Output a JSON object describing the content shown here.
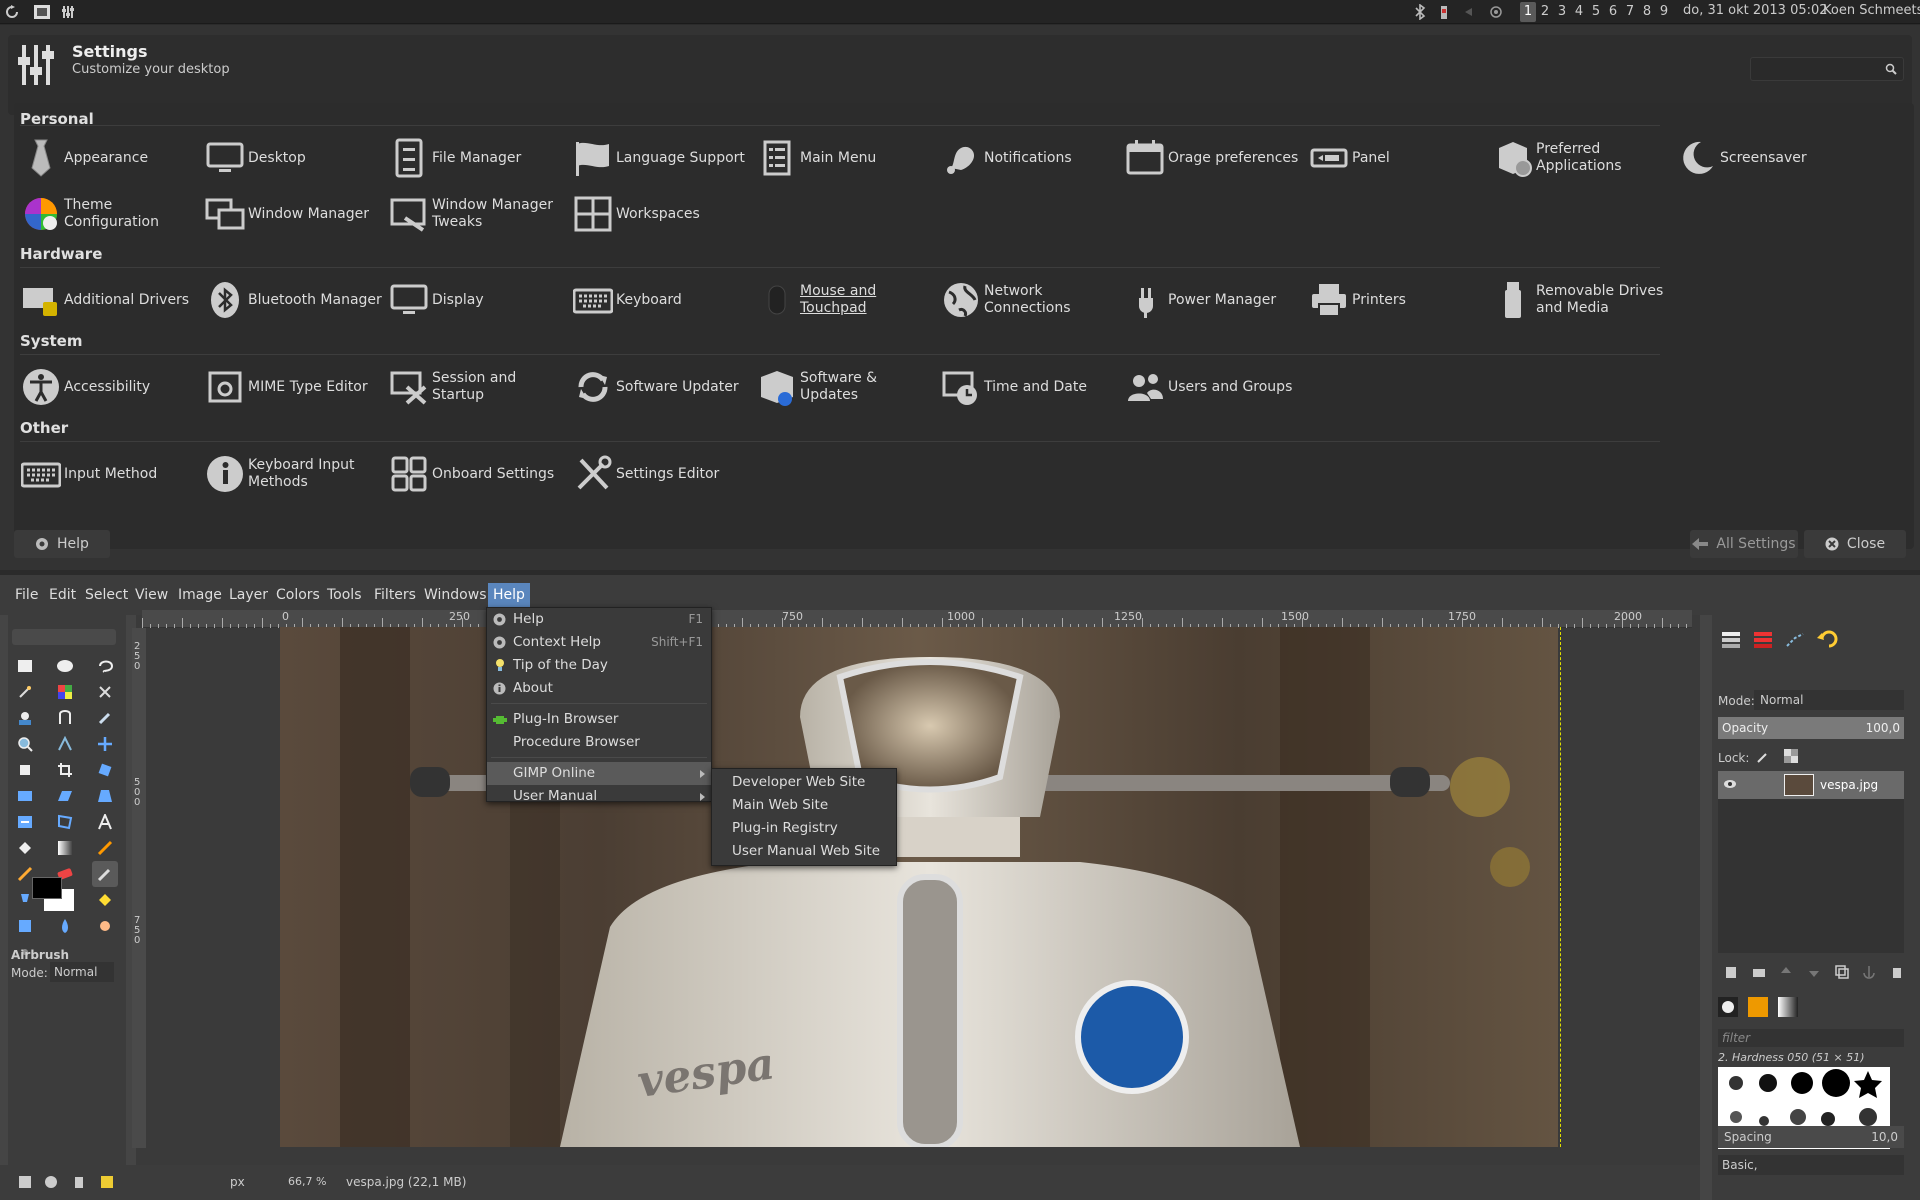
{
  "top_panel": {
    "workspaces": [
      "1",
      "2",
      "3",
      "4",
      "5",
      "6",
      "7",
      "8",
      "9"
    ],
    "active_workspace": "1",
    "datetime": "do, 31 okt 2013 05:02",
    "user": "Koen Schmeets"
  },
  "settings": {
    "title": "Settings",
    "subtitle": "Customize your desktop",
    "search_placeholder": "",
    "sections": {
      "personal": {
        "label": "Personal",
        "items": [
          {
            "label": "Appearance",
            "icon": "tie-icon"
          },
          {
            "label": "Desktop",
            "icon": "monitor-icon"
          },
          {
            "label": "File Manager",
            "icon": "file-cabinet-icon"
          },
          {
            "label": "Language Support",
            "icon": "flag-icon"
          },
          {
            "label": "Main Menu",
            "icon": "menu-list-icon"
          },
          {
            "label": "Notifications",
            "icon": "bell-icon"
          },
          {
            "label": "Orage preferences",
            "icon": "calendar-icon"
          },
          {
            "label": "Panel",
            "icon": "panel-icon"
          },
          {
            "label": "Preferred Applications",
            "icon": "applications-icon"
          },
          {
            "label": "Screensaver",
            "icon": "moon-icon"
          },
          {
            "label": "Theme Configuration",
            "icon": "color-wheel-icon"
          },
          {
            "label": "Window Manager",
            "icon": "windows-icon"
          },
          {
            "label": "Window Manager Tweaks",
            "icon": "window-tweaks-icon"
          },
          {
            "label": "Workspaces",
            "icon": "workspaces-icon"
          }
        ]
      },
      "hardware": {
        "label": "Hardware",
        "items": [
          {
            "label": "Additional Drivers",
            "icon": "driver-card-icon"
          },
          {
            "label": "Bluetooth Manager",
            "icon": "bluetooth-icon"
          },
          {
            "label": "Display",
            "icon": "display-icon"
          },
          {
            "label": "Keyboard",
            "icon": "keyboard-icon"
          },
          {
            "label": "Mouse and Touchpad",
            "icon": "mouse-icon"
          },
          {
            "label": "Network Connections",
            "icon": "globe-icon"
          },
          {
            "label": "Power Manager",
            "icon": "power-plug-icon"
          },
          {
            "label": "Printers",
            "icon": "printer-icon"
          },
          {
            "label": "Removable Drives and Media",
            "icon": "usb-drive-icon"
          }
        ]
      },
      "system": {
        "label": "System",
        "items": [
          {
            "label": "Accessibility",
            "icon": "accessibility-icon"
          },
          {
            "label": "MIME Type Editor",
            "icon": "mime-gear-icon"
          },
          {
            "label": "Session and Startup",
            "icon": "session-tools-icon"
          },
          {
            "label": "Software Updater",
            "icon": "refresh-icon"
          },
          {
            "label": "Software & Updates",
            "icon": "software-box-icon"
          },
          {
            "label": "Time and Date",
            "icon": "clock-calendar-icon"
          },
          {
            "label": "Users and Groups",
            "icon": "users-icon"
          }
        ]
      },
      "other": {
        "label": "Other",
        "items": [
          {
            "label": "Input Method",
            "icon": "keyboard-icon"
          },
          {
            "label": "Keyboard Input Methods",
            "icon": "info-icon"
          },
          {
            "label": "Onboard Settings",
            "icon": "onboard-keys-icon"
          },
          {
            "label": "Settings Editor",
            "icon": "wrench-screwdriver-icon"
          }
        ]
      }
    },
    "buttons": {
      "help": "Help",
      "all_settings": "All Settings",
      "close": "Close"
    }
  },
  "gimp": {
    "menubar": [
      "File",
      "Edit",
      "Select",
      "View",
      "Image",
      "Layer",
      "Colors",
      "Tools",
      "Filters",
      "Windows",
      "Help"
    ],
    "open_menu": "Help",
    "help_menu": [
      {
        "label": "Help",
        "shortcut": "F1",
        "icon": "help-icon"
      },
      {
        "label": "Context Help",
        "shortcut": "Shift+F1",
        "icon": "context-help-icon"
      },
      {
        "label": "Tip of the Day",
        "shortcut": "",
        "icon": "lightbulb-icon"
      },
      {
        "label": "About",
        "shortcut": "",
        "icon": "info-icon"
      },
      {
        "label": "Plug-In Browser",
        "shortcut": "",
        "icon": "plugin-icon"
      },
      {
        "label": "Procedure Browser",
        "shortcut": "",
        "icon": ""
      },
      {
        "label": "GIMP Online",
        "shortcut": "",
        "icon": ""
      },
      {
        "label": "User Manual",
        "shortcut": "",
        "icon": ""
      }
    ],
    "submenu": [
      "Developer Web Site",
      "Main Web Site",
      "Plug-in Registry",
      "User Manual Web Site"
    ],
    "ruler_ticks": [
      "0",
      "250",
      "500",
      "750",
      "1000",
      "1250",
      "1500",
      "1750",
      "2000"
    ],
    "vruler_ticks": [
      "2",
      "5",
      "0",
      "5",
      "0",
      "0",
      "7",
      "5",
      "0"
    ],
    "tool_options": {
      "name": "Airbrush",
      "mode_label": "Mode:",
      "mode_value": "Normal"
    },
    "status": {
      "unit": "px",
      "zoom": "66,7 %",
      "file": "vespa.jpg (22,1 MB)"
    },
    "layers": {
      "mode_label": "Mode:",
      "mode_value": "Normal",
      "opacity_label": "Opacity",
      "opacity_value": "100,0",
      "lock_label": "Lock:",
      "layer_name": "vespa.jpg"
    },
    "brushes": {
      "filter_placeholder": "filter",
      "brush_name": "2. Hardness 050 (51 × 51)",
      "preset": "Basic,",
      "spacing_label": "Spacing",
      "spacing_value": "10,0"
    },
    "image_text": "vespa"
  },
  "colors": {
    "accent_blue": "#5a86bd",
    "panel_bg": "#2c2c2c"
  }
}
